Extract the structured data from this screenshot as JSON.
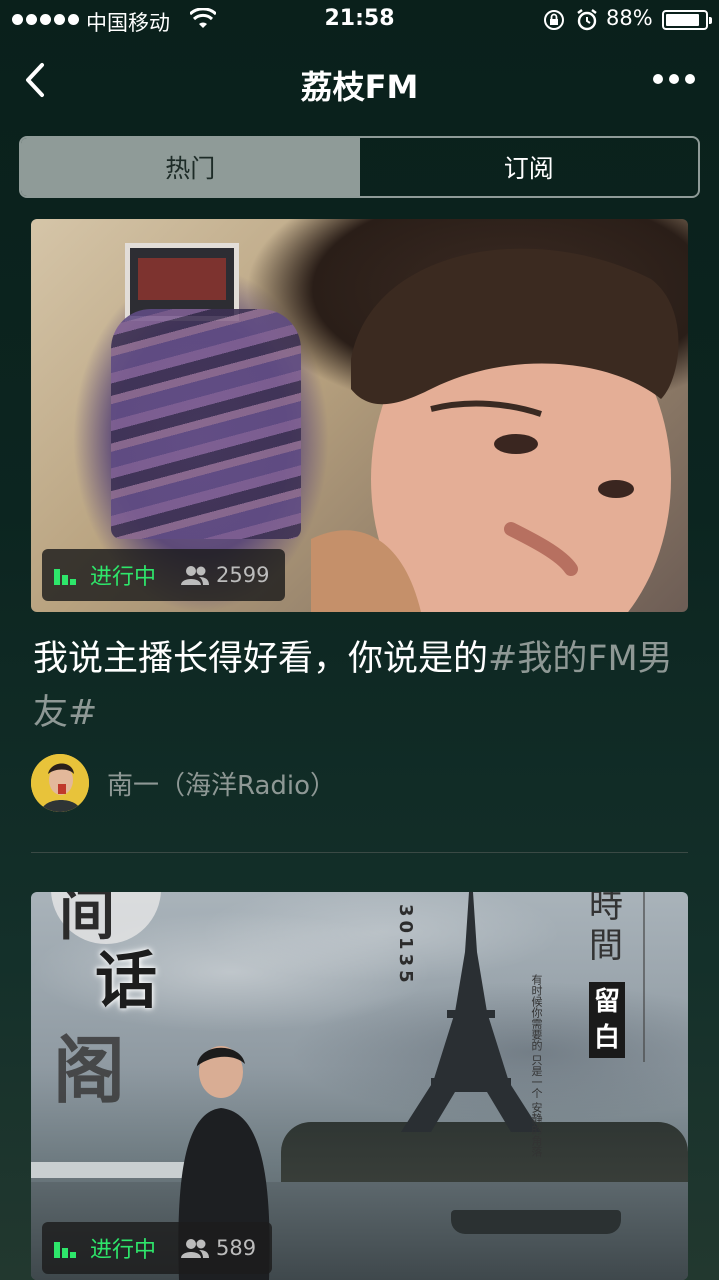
{
  "status_bar": {
    "carrier": "中国移动",
    "time": "21:58",
    "battery_percent_label": "88%",
    "battery_level": 0.88
  },
  "nav": {
    "title": "荔枝FM"
  },
  "tabs": [
    {
      "label": "热门",
      "active": true
    },
    {
      "label": "订阅",
      "active": false
    }
  ],
  "cards": [
    {
      "status": "进行中",
      "listeners": "2599",
      "title_main": "我说主播长得好看，你说是的",
      "title_tag": "#我的FM男友#",
      "author": "南一（海洋Radio）"
    },
    {
      "status": "进行中",
      "listeners": "589",
      "image_text": {
        "top_char": "间",
        "char1": "话",
        "char2": "阁",
        "number": "30135",
        "heading": "時間",
        "badge": "留白",
        "quote": "有时候你需要的 只是一个 安静的角落"
      }
    }
  ],
  "colors": {
    "background": "#0c2520",
    "live_green": "#2ee66b",
    "muted_text": "#8e9895",
    "tab_active_bg": "#8f9b98"
  },
  "icons": {
    "back": "chevron-left-icon",
    "more": "more-dots-icon",
    "live": "equalizer-icon",
    "listeners": "people-icon",
    "wifi": "wifi-icon",
    "lock": "rotation-lock-icon",
    "alarm": "alarm-icon",
    "battery": "battery-icon"
  }
}
